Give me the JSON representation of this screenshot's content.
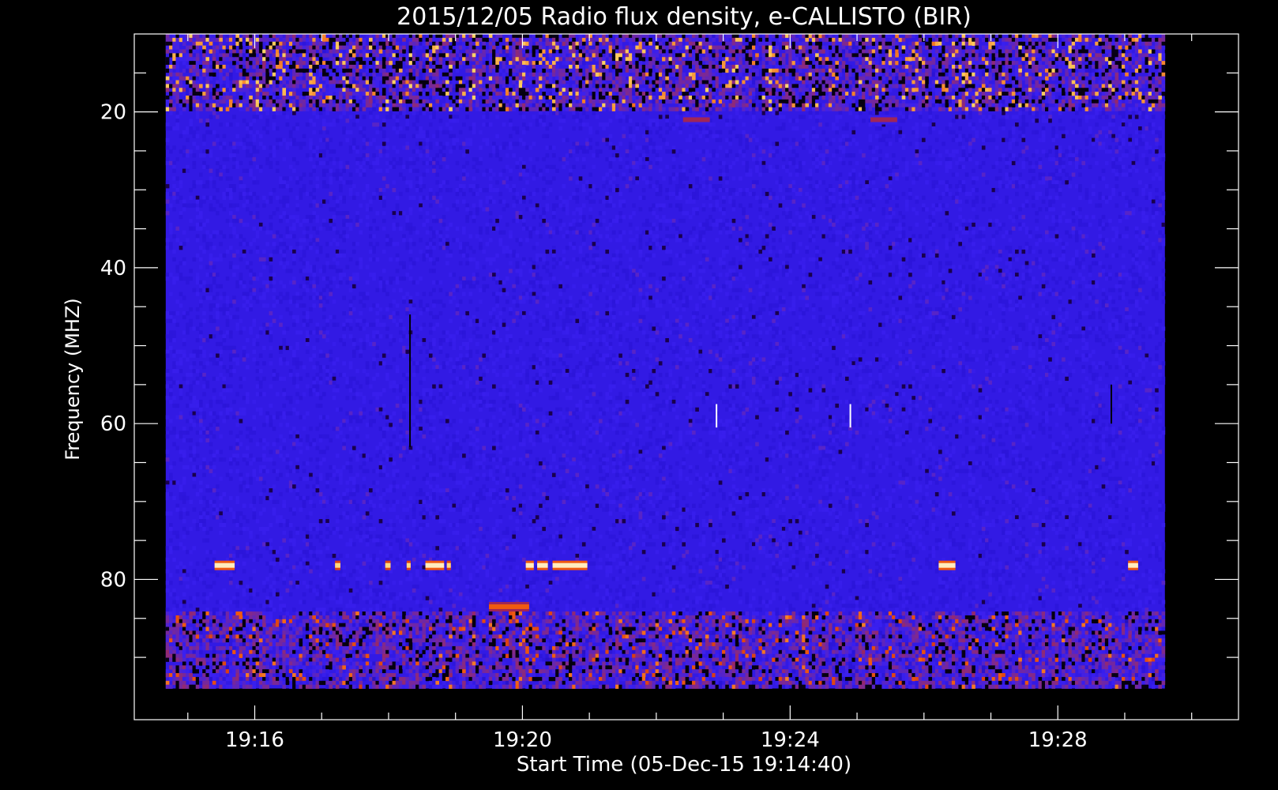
{
  "chart_data": {
    "type": "heatmap",
    "title": "2015/12/05  Radio flux density, e-CALLISTO (BIR)",
    "xlabel": "Start Time (05-Dec-15 19:14:40)",
    "ylabel": "Frequency (MHZ)",
    "x_tick_labels": [
      "19:16",
      "19:20",
      "19:24",
      "19:28"
    ],
    "x_tick_values_minutes": [
      16,
      20,
      24,
      28
    ],
    "x_minor_tick_values_minutes": [
      15,
      16,
      17,
      18,
      19,
      20,
      21,
      22,
      23,
      24,
      25,
      26,
      27,
      28,
      29,
      30
    ],
    "y_tick_labels": [
      "20",
      "40",
      "60",
      "80"
    ],
    "y_tick_values": [
      20,
      40,
      60,
      80
    ],
    "y_minor_tick_values": [
      15,
      20,
      25,
      30,
      35,
      40,
      45,
      50,
      55,
      60,
      65,
      70,
      75,
      80,
      85,
      90
    ],
    "xlim_minutes": [
      14.2,
      30.7
    ],
    "ylim": [
      10,
      98
    ],
    "data_time_range_minutes": [
      14.67,
      29.6
    ],
    "data_freq_range": [
      10,
      94
    ],
    "y_reversed": true,
    "grid": false,
    "colormap": [
      "#000000",
      "#1a0050",
      "#2a14d8",
      "#3a20f0",
      "#8a2a80",
      "#c02018",
      "#f05a10",
      "#ffd060",
      "#ffffff"
    ],
    "features": [
      {
        "kind": "band",
        "freq_range": [
          10,
          20
        ],
        "level": 0.6,
        "note": ""
      },
      {
        "kind": "band",
        "freq_range": [
          84,
          94
        ],
        "level": 0.35,
        "note": ""
      },
      {
        "kind": "segment",
        "freq": 78.2,
        "time_minutes": [
          15.4,
          15.7
        ],
        "level": 0.95
      },
      {
        "kind": "segment",
        "freq": 78.2,
        "time_minutes": [
          17.2,
          17.28
        ],
        "level": 0.9
      },
      {
        "kind": "segment",
        "freq": 78.2,
        "time_minutes": [
          17.95,
          18.03
        ],
        "level": 0.9
      },
      {
        "kind": "segment",
        "freq": 78.2,
        "time_minutes": [
          18.27,
          18.33
        ],
        "level": 0.9
      },
      {
        "kind": "segment",
        "freq": 78.2,
        "time_minutes": [
          18.55,
          18.83
        ],
        "level": 0.95
      },
      {
        "kind": "segment",
        "freq": 78.2,
        "time_minutes": [
          18.87,
          18.93
        ],
        "level": 0.9
      },
      {
        "kind": "segment",
        "freq": 78.2,
        "time_minutes": [
          20.05,
          20.17
        ],
        "level": 0.95
      },
      {
        "kind": "segment",
        "freq": 78.2,
        "time_minutes": [
          20.22,
          20.38
        ],
        "level": 0.95
      },
      {
        "kind": "segment",
        "freq": 78.2,
        "time_minutes": [
          20.45,
          20.97
        ],
        "level": 0.95
      },
      {
        "kind": "segment",
        "freq": 78.2,
        "time_minutes": [
          26.22,
          26.47
        ],
        "level": 0.95
      },
      {
        "kind": "segment",
        "freq": 78.2,
        "time_minutes": [
          29.05,
          29.2
        ],
        "level": 0.95
      },
      {
        "kind": "segment",
        "freq": 83.5,
        "time_minutes": [
          19.5,
          20.1
        ],
        "level": 0.75
      },
      {
        "kind": "segment",
        "freq": 21,
        "time_minutes": [
          22.4,
          22.8
        ],
        "level": 0.55
      },
      {
        "kind": "segment",
        "freq": 21,
        "time_minutes": [
          25.2,
          25.6
        ],
        "level": 0.55
      },
      {
        "kind": "streak",
        "time_minutes": 18.32,
        "freq_range": [
          46,
          63
        ],
        "level": 0.0
      },
      {
        "kind": "streak",
        "time_minutes": 28.8,
        "freq_range": [
          55,
          60
        ],
        "level": 0.0
      },
      {
        "kind": "streak",
        "time_minutes": 22.9,
        "freq_range": [
          57.5,
          60.5
        ],
        "level": 1.0
      },
      {
        "kind": "streak",
        "time_minutes": 24.9,
        "freq_range": [
          57.5,
          60.5
        ],
        "level": 1.0
      }
    ]
  }
}
